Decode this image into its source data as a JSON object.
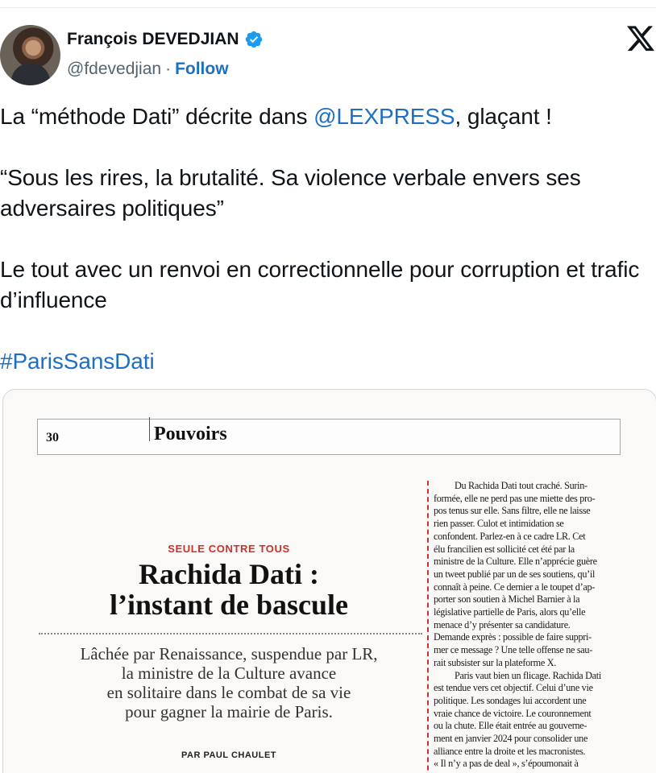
{
  "author": {
    "name": "François DEVEDJIAN",
    "handle": "@fdevedjian",
    "separator": "·",
    "follow_label": "Follow"
  },
  "icons": {
    "verified": "verified-badge-icon",
    "platform": "x-logo-icon"
  },
  "colors": {
    "link": "#1d6fc4",
    "verified": "#1d9bf0",
    "kicker": "#c8332b"
  },
  "tweet": {
    "p1_before": "La “méthode Dati” décrite dans ",
    "p1_mention": "@LEXPRESS",
    "p1_after": ", glaçant !",
    "p2": "“Sous les rires, la brutalité. Sa violence verbale envers ses adversaires politiques”",
    "p3": "Le tout avec un renvoi en correctionnelle pour corruption et trafic d’influence",
    "hashtag": "#ParisSansDati"
  },
  "article": {
    "page_number": "30",
    "section": "Pouvoirs",
    "kicker": "SEULE CONTRE TOUS",
    "headline_line1": "Rachida Dati :",
    "headline_line2": "l’instant de bascule",
    "standfirst_line1": "Lâchée par Renaissance, suspendue par LR,",
    "standfirst_line2": "la ministre de la Culture avance",
    "standfirst_line3": "en solitaire dans le combat de sa vie",
    "standfirst_line4": "pour gagner la mairie de Paris.",
    "byline": "PAR PAUL CHAULET",
    "body_lines": [
      "Du Rachida Dati tout craché. Surin-",
      "formée, elle ne perd pas une miette des pro-",
      "pos tenus sur elle. Sans filtre, elle ne laisse",
      "rien passer. Culot et intimidation se",
      "confondent. Parlez-en à ce cadre LR. Cet",
      "élu francilien est sollicité cet été par la",
      "ministre de la Culture. Elle n’apprécie guère",
      "un tweet publié par un de ses soutiens, qu’il",
      "connaît à peine. Ce dernier a le toupet d’ap-",
      "porter son soutien à Michel Barnier à la",
      "législative partielle de Paris, alors qu’elle",
      "menace d’y présenter sa candidature.",
      "Demande exprès : possible de faire suppri-",
      "mer ce message ? Une telle offense ne sau-",
      "rait subsister sur la plateforme X.",
      "Paris vaut bien un flicage. Rachida Dati",
      "est tendue vers cet objectif. Celui d’une vie",
      "politique. Les sondages lui accordent une",
      "vraie chance de victoire. Le couronnement",
      "ou la chute. Elle était entrée au gouverne-",
      "ment en janvier 2024 pour consolider une",
      "alliance entre la droite et les macronistes.",
      "« Il n’y a pas de deal », s’époumonait à"
    ]
  }
}
